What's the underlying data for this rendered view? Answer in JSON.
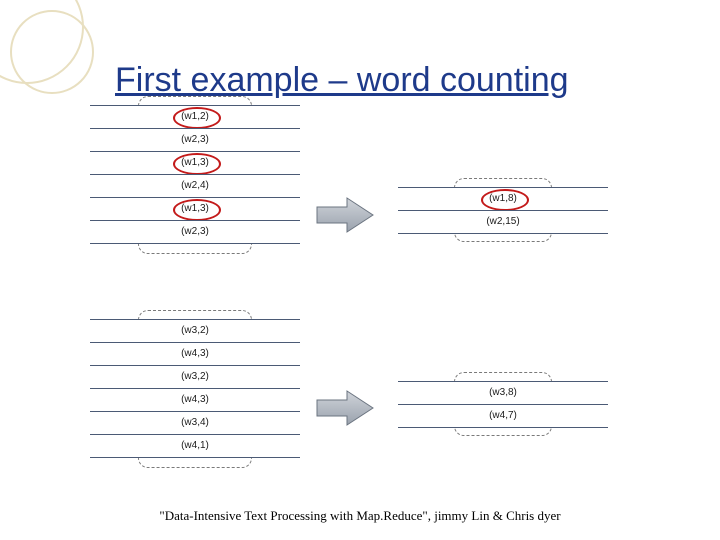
{
  "title": "First example – word counting",
  "footer": "\"Data-Intensive Text Processing with Map.Reduce\", jimmy Lin & Chris dyer",
  "top_input": {
    "rows": [
      "(w1,2)",
      "(w2,3)",
      "(w1,3)",
      "(w2,4)",
      "(w1,3)",
      "(w2,3)"
    ],
    "circled": [
      0,
      2,
      4
    ]
  },
  "top_output": {
    "rows": [
      "(w1,8)",
      "(w2,15)"
    ],
    "circled": [
      0
    ]
  },
  "bottom_input": {
    "rows": [
      "(w3,2)",
      "(w4,3)",
      "(w3,2)",
      "(w4,3)",
      "(w3,4)",
      "(w4,1)"
    ],
    "circled": []
  },
  "bottom_output": {
    "rows": [
      "(w3,8)",
      "(w4,7)"
    ],
    "circled": []
  }
}
